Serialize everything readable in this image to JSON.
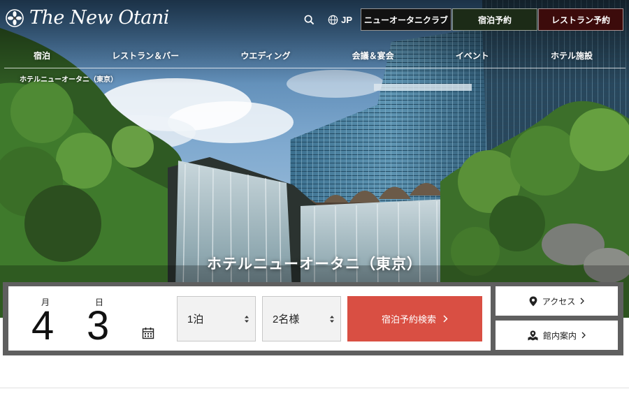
{
  "brand": {
    "logo_text": "The New Otani"
  },
  "header": {
    "language_label": "JP",
    "buttons": {
      "club": "ニューオータニクラブ",
      "stay_booking": "宿泊予約",
      "restaurant_booking": "レストラン予約"
    }
  },
  "nav": {
    "items": [
      "宿泊",
      "レストラン＆バー",
      "ウエディング",
      "会議＆宴会",
      "イベント",
      "ホテル施設"
    ]
  },
  "breadcrumb": {
    "current": "ホテルニューオータニ（東京）"
  },
  "hero": {
    "title": "ホテルニューオータニ（東京）"
  },
  "booking": {
    "month_label": "月",
    "day_label": "日",
    "month_value": "4",
    "day_value": "3",
    "nights_value": "1泊",
    "guests_value": "2名様",
    "search_label": "宿泊予約検索"
  },
  "side_links": {
    "access_label": "アクセス",
    "floor_guide_label": "館内案内"
  },
  "colors": {
    "search_button": "#d94f43",
    "club_button": "#111111",
    "stay_button": "#1c2b17",
    "restaurant_button": "#3c0b0b",
    "booking_frame": "#5f5f5f"
  }
}
